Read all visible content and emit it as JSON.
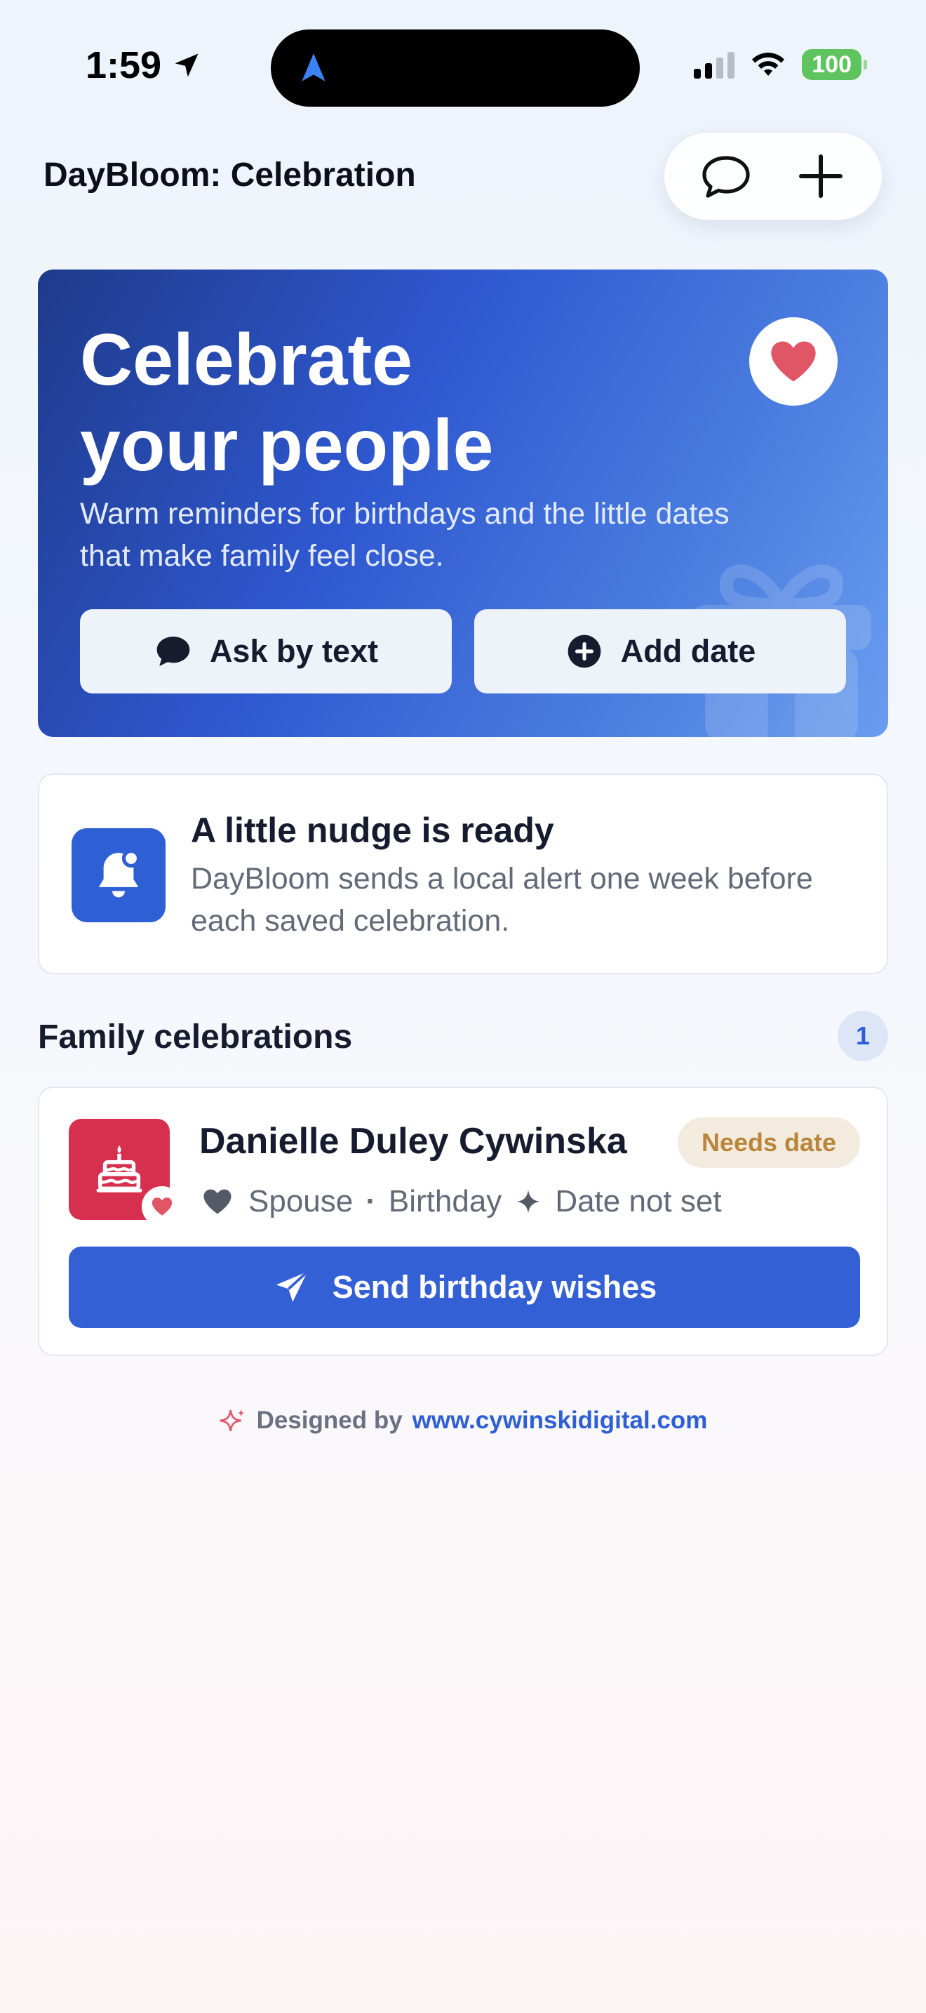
{
  "status_bar": {
    "time": "1:59",
    "battery": "100",
    "location_icon": "location-arrow-icon",
    "island_icon": "navigation-arrow-icon",
    "signal_icon": "cellular-signal-icon",
    "wifi_icon": "wifi-icon"
  },
  "nav": {
    "title": "DayBloom: Celebration",
    "chat_icon": "chat-bubble-icon",
    "add_icon": "plus-icon"
  },
  "hero": {
    "title_line1": "Celebrate",
    "title_line2": "your people",
    "subtitle": "Warm reminders for birthdays and the little dates that make family feel close.",
    "ask_label": "Ask by text",
    "add_label": "Add date",
    "heart_color": "#e05667",
    "gradient_start": "#1e3a8a",
    "gradient_end": "#6a9df0"
  },
  "nudge": {
    "title": "A little nudge is ready",
    "body": "DayBloom sends a local alert one week before each saved celebration.",
    "icon": "bell-icon"
  },
  "celebrations": {
    "section_title": "Family celebrations",
    "count": "1",
    "items": [
      {
        "name": "Danielle Duley Cywinska",
        "badge": "Needs date",
        "relation": "Spouse",
        "separator": "·",
        "occasion": "Birthday",
        "date_status": "Date not set",
        "action_label": "Send birthday wishes",
        "avatar_icon": "birthday-cake-icon",
        "avatar_color": "#d6304e"
      }
    ]
  },
  "footer": {
    "prefix": "Designed by",
    "link": "www.cywinskidigital.com"
  },
  "colors": {
    "accent": "#3460d6",
    "badge_bg": "#f3ebde",
    "badge_text": "#b9853a"
  }
}
